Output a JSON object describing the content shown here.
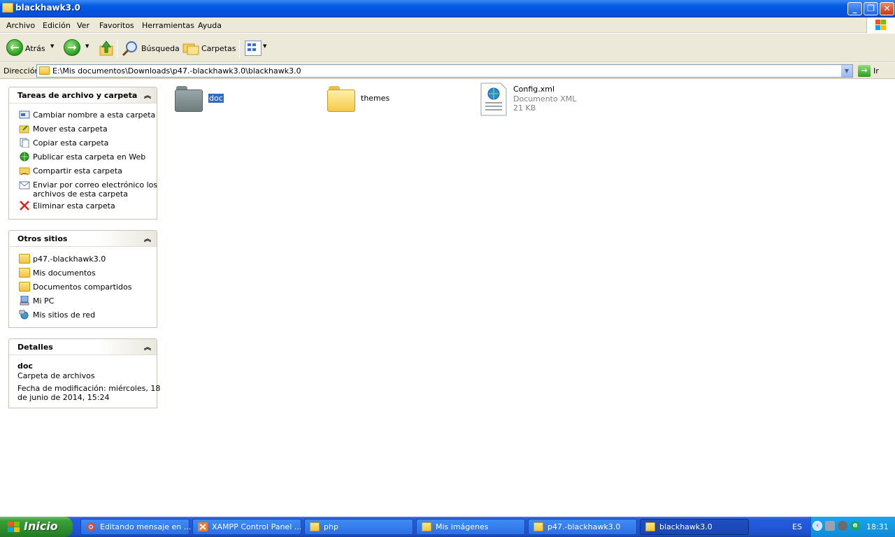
{
  "window": {
    "title": "blackhawk3.0"
  },
  "menu": [
    "Archivo",
    "Edición",
    "Ver",
    "Favoritos",
    "Herramientas",
    "Ayuda"
  ],
  "toolbar": {
    "back": "Atrás",
    "search": "Búsqueda",
    "folders": "Carpetas"
  },
  "address": {
    "label": "Dirección",
    "path": "E:\\Mis documentos\\Downloads\\p47.-blackhawk3.0\\blackhawk3.0",
    "go": "Ir"
  },
  "tasks_panel": {
    "title": "Tareas de archivo y carpeta",
    "items": [
      "Cambiar nombre a esta carpeta",
      "Mover esta carpeta",
      "Copiar esta carpeta",
      "Publicar esta carpeta en Web",
      "Compartir esta carpeta",
      "Enviar por correo electrónico los",
      "archivos de esta carpeta",
      "Eliminar esta carpeta"
    ]
  },
  "other_places": {
    "title": "Otros sitios",
    "items": [
      "p47.-blackhawk3.0",
      "Mis documentos",
      "Documentos compartidos",
      "Mi PC",
      "Mis sitios de red"
    ]
  },
  "details": {
    "title": "Detalles",
    "name": "doc",
    "type": "Carpeta de archivos",
    "modified_line1": "Fecha de modificación: miércoles, 18",
    "modified_line2": "de junio de 2014, 15:24"
  },
  "files": [
    {
      "name": "doc",
      "kind": "folder",
      "selected": true
    },
    {
      "name": "themes",
      "kind": "folder",
      "selected": false
    },
    {
      "name": "Config.xml",
      "type": "Documento XML",
      "size": "21 KB",
      "kind": "xml"
    }
  ],
  "taskbar": {
    "start": "Inicio",
    "tasks": [
      "Editando mensaje en ...",
      "XAMPP Control Panel ...",
      "php",
      "Mis imágenes",
      "p47.-blackhawk3.0",
      "blackhawk3.0"
    ],
    "lang": "ES",
    "time": "18:31"
  }
}
